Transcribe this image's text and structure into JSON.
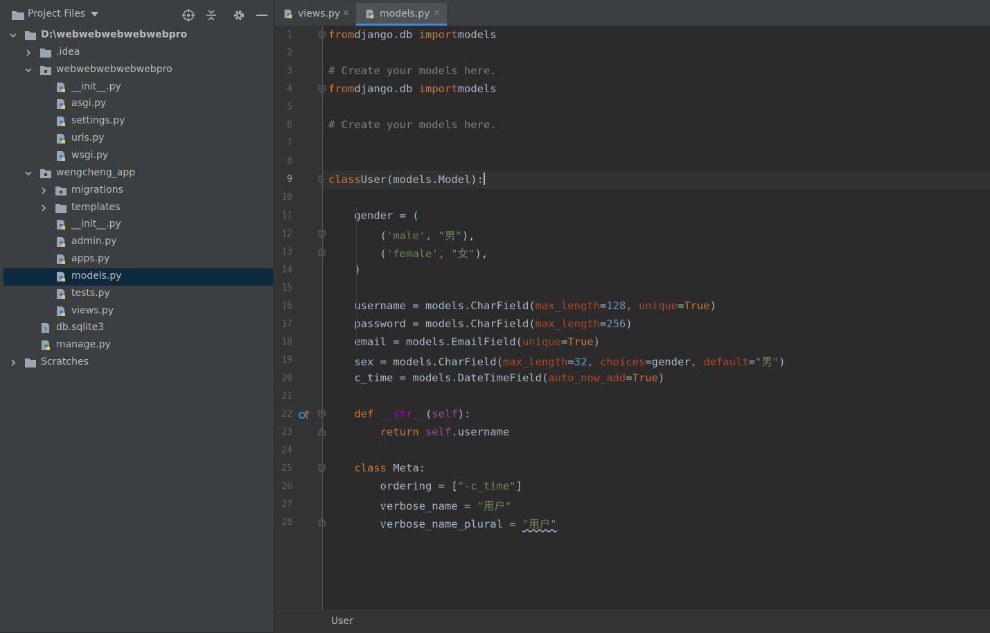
{
  "sidebar": {
    "title": "Project Files",
    "tree": [
      {
        "label": "D:\\webwebwebwebwebpro",
        "type": "folder",
        "level": 0,
        "expanded": true,
        "bold": true
      },
      {
        "label": ".idea",
        "type": "folder",
        "level": 1,
        "expanded": false
      },
      {
        "label": "webwebwebwebwebpro",
        "type": "package",
        "level": 1,
        "expanded": true
      },
      {
        "label": "__init__.py",
        "type": "python",
        "level": 2
      },
      {
        "label": "asgi.py",
        "type": "python",
        "level": 2
      },
      {
        "label": "settings.py",
        "type": "python",
        "level": 2
      },
      {
        "label": "urls.py",
        "type": "python",
        "level": 2
      },
      {
        "label": "wsgi.py",
        "type": "python",
        "level": 2
      },
      {
        "label": "wengcheng_app",
        "type": "package",
        "level": 1,
        "expanded": true
      },
      {
        "label": "migrations",
        "type": "package",
        "level": 2,
        "expanded": false
      },
      {
        "label": "templates",
        "type": "folder",
        "level": 2,
        "expanded": false
      },
      {
        "label": "__init__.py",
        "type": "python",
        "level": 2
      },
      {
        "label": "admin.py",
        "type": "python",
        "level": 2
      },
      {
        "label": "apps.py",
        "type": "python",
        "level": 2
      },
      {
        "label": "models.py",
        "type": "python",
        "level": 2,
        "selected": true
      },
      {
        "label": "tests.py",
        "type": "python",
        "level": 2
      },
      {
        "label": "views.py",
        "type": "python",
        "level": 2
      },
      {
        "label": "db.sqlite3",
        "type": "unknown",
        "level": 1
      },
      {
        "label": "manage.py",
        "type": "python",
        "level": 1
      },
      {
        "label": "Scratches",
        "type": "folder",
        "level": 0,
        "expanded": false
      }
    ]
  },
  "tabs": [
    {
      "label": "views.py",
      "active": false
    },
    {
      "label": "models.py",
      "active": true
    }
  ],
  "editor": {
    "current_line": 9,
    "lines": [
      [
        [
          "kw",
          "from"
        ],
        [
          "",
          "django.db "
        ],
        [
          "kw",
          "import"
        ],
        [
          "",
          "models"
        ]
      ],
      [],
      [
        [
          "cm",
          "# Create your models here."
        ]
      ],
      [
        [
          "kw",
          "from"
        ],
        [
          "",
          "django.db "
        ],
        [
          "kw",
          "import"
        ],
        [
          "",
          "models"
        ]
      ],
      [],
      [
        [
          "cm",
          "# Create your models here."
        ]
      ],
      [],
      [],
      [
        [
          "kw",
          "class"
        ],
        [
          "",
          "User(models.Model):"
        ]
      ],
      [],
      [
        [
          "",
          "    gender = ("
        ]
      ],
      [
        [
          "",
          "        ("
        ],
        [
          "st",
          "'male'"
        ],
        [
          "kw",
          ", "
        ],
        [
          "st",
          "\"男\""
        ],
        [
          "",
          "),"
        ]
      ],
      [
        [
          "",
          "        ("
        ],
        [
          "st",
          "'female'"
        ],
        [
          "kw",
          ", "
        ],
        [
          "st",
          "\"女\""
        ],
        [
          "",
          "),"
        ]
      ],
      [
        [
          "",
          "    )"
        ]
      ],
      [],
      [
        [
          "",
          "    username = models.CharField("
        ],
        [
          "pr",
          "max_length"
        ],
        [
          "",
          "="
        ],
        [
          "nm",
          "128"
        ],
        [
          "kw",
          ", "
        ],
        [
          "pr",
          "unique"
        ],
        [
          "",
          "="
        ],
        [
          "kw",
          "True"
        ],
        [
          "",
          ")"
        ]
      ],
      [
        [
          "",
          "    password = models.CharField("
        ],
        [
          "pr",
          "max_length"
        ],
        [
          "",
          "="
        ],
        [
          "nm",
          "256"
        ],
        [
          "",
          ")"
        ]
      ],
      [
        [
          "",
          "    email = models.EmailField("
        ],
        [
          "pr",
          "unique"
        ],
        [
          "",
          "="
        ],
        [
          "kw",
          "True"
        ],
        [
          "",
          ")"
        ]
      ],
      [
        [
          "",
          "    sex = models.CharField("
        ],
        [
          "pr",
          "max_length"
        ],
        [
          "",
          "="
        ],
        [
          "nm",
          "32"
        ],
        [
          "kw",
          ", "
        ],
        [
          "pr",
          "choices"
        ],
        [
          "",
          "=gender"
        ],
        [
          "kw",
          ", "
        ],
        [
          "pr",
          "default"
        ],
        [
          "",
          "="
        ],
        [
          "st",
          "\"男\""
        ],
        [
          "",
          ")"
        ]
      ],
      [
        [
          "",
          "    c_time = models.DateTimeField("
        ],
        [
          "pr",
          "auto_now_add"
        ],
        [
          "",
          "="
        ],
        [
          "kw",
          "True"
        ],
        [
          "",
          ")"
        ]
      ],
      [],
      [
        [
          "",
          "    "
        ],
        [
          "kw",
          "def "
        ],
        [
          "mg",
          "__str__"
        ],
        [
          "",
          "("
        ],
        [
          "sf",
          "self"
        ],
        [
          "",
          "):"
        ]
      ],
      [
        [
          "",
          "        "
        ],
        [
          "kw",
          "return "
        ],
        [
          "sf",
          "self"
        ],
        [
          "",
          ".username"
        ]
      ],
      [],
      [
        [
          "",
          "    "
        ],
        [
          "kw",
          "class "
        ],
        [
          "",
          "Meta:"
        ]
      ],
      [
        [
          "",
          "        ordering = ["
        ],
        [
          "st",
          "\"-c_time\""
        ],
        [
          "",
          "]"
        ]
      ],
      [
        [
          "",
          "        verbose_name = "
        ],
        [
          "st",
          "\"用户\""
        ]
      ],
      [
        [
          "",
          "        verbose_name_plural = "
        ],
        [
          "stu",
          "\"用户\""
        ]
      ]
    ]
  },
  "status_bar": {
    "breadcrumb": "User"
  }
}
